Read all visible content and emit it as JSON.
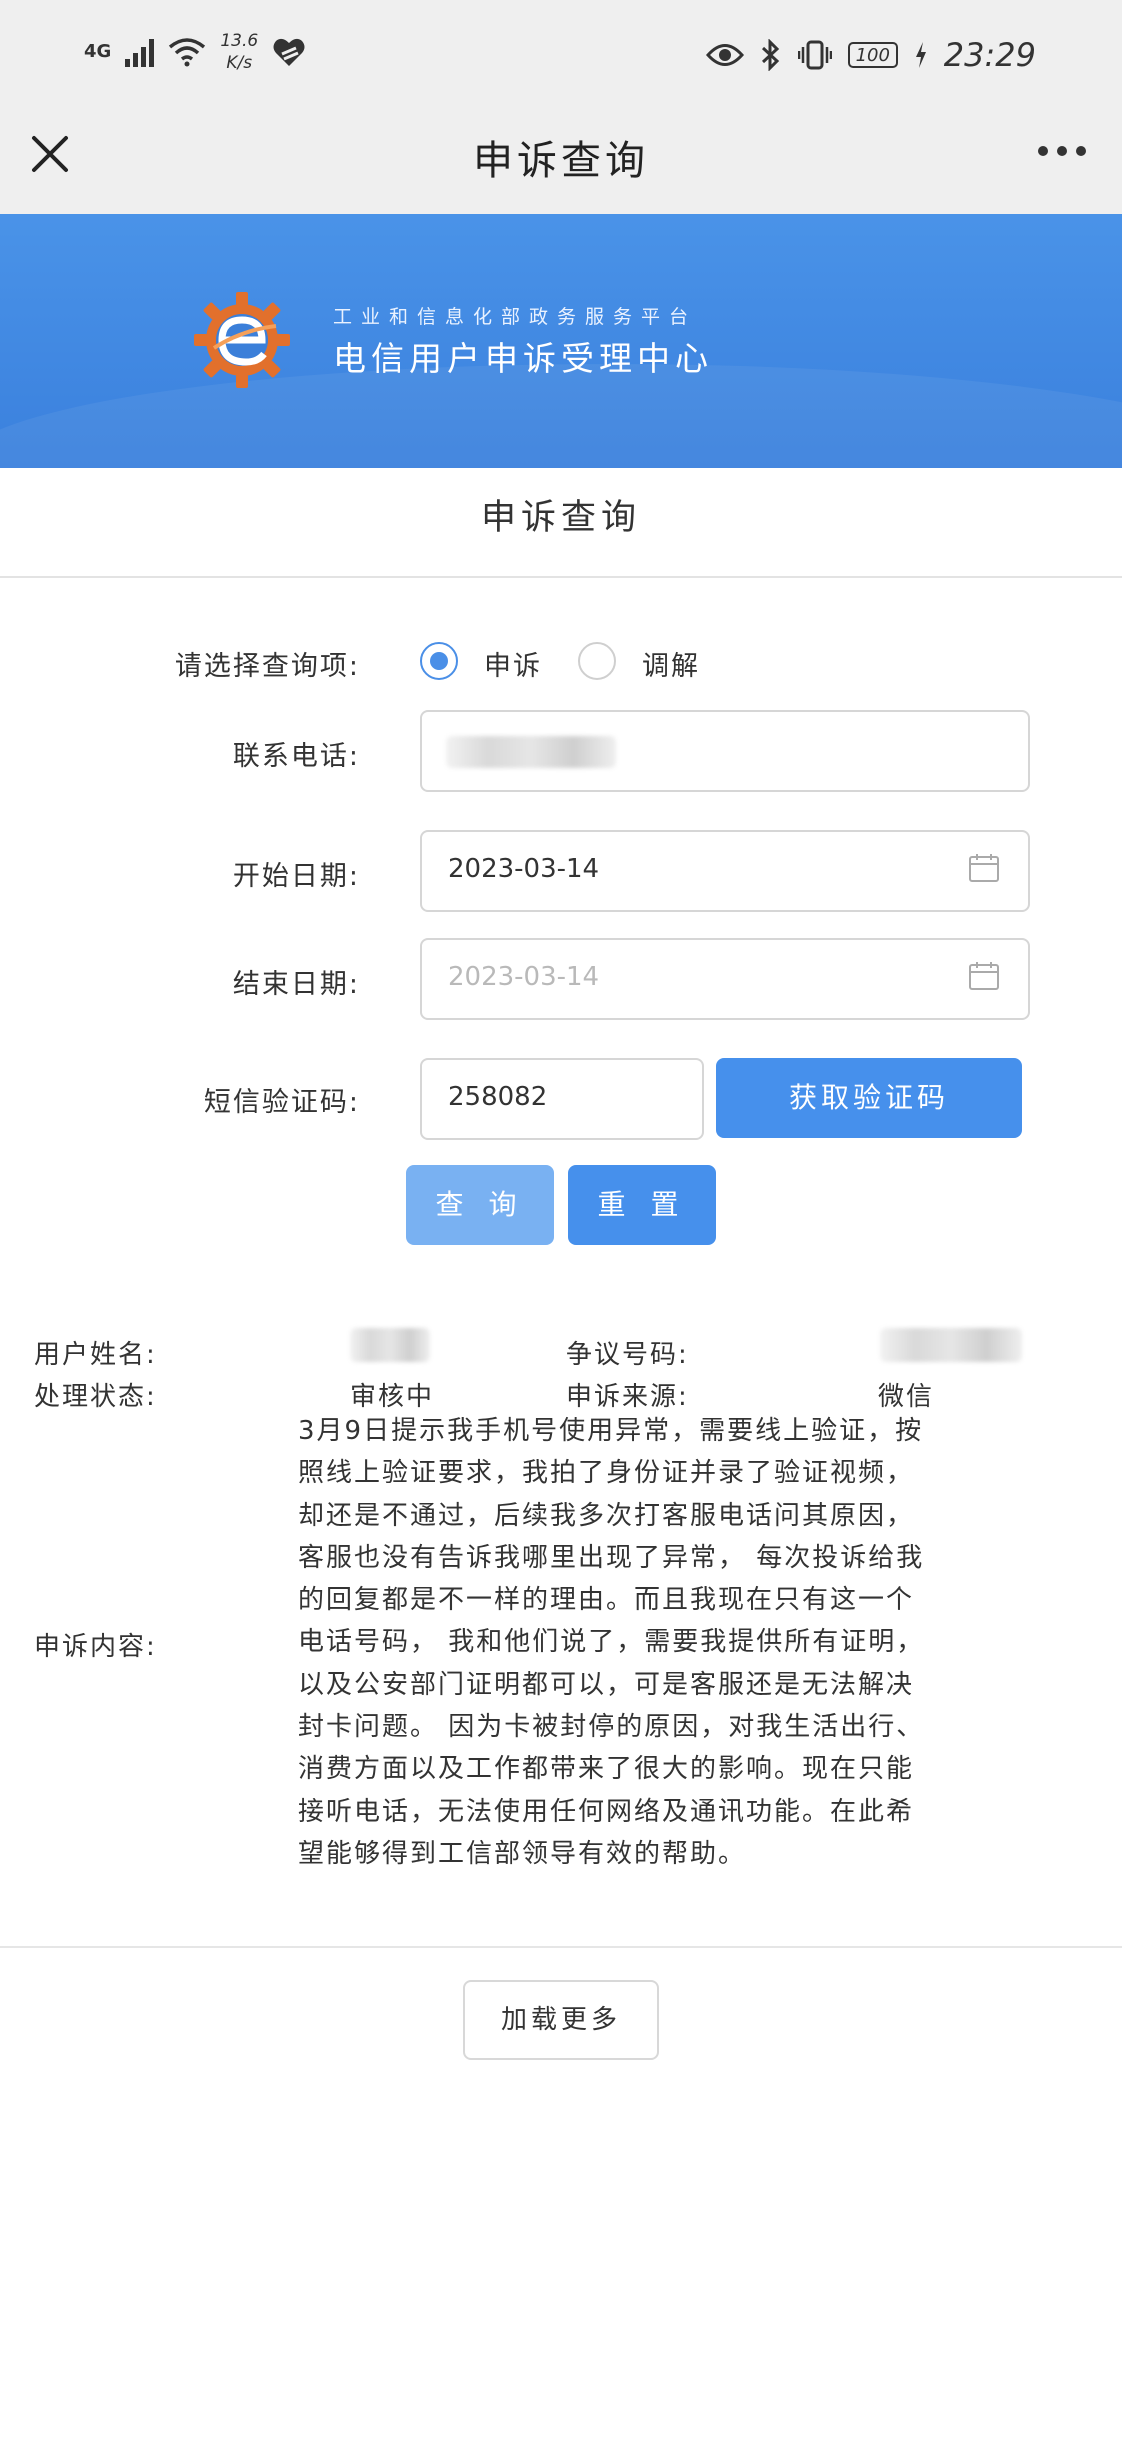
{
  "status_bar": {
    "network": "4G",
    "speed_value": "13.6",
    "speed_unit": "K/s",
    "battery": "100",
    "time": "23:29"
  },
  "nav": {
    "title": "申诉查询",
    "close_icon": "close-icon",
    "more_icon": "more-icon"
  },
  "banner": {
    "subtitle": "工业和信息化部政务服务平台",
    "title": "电信用户申诉受理中心"
  },
  "section_title": "申诉查询",
  "form": {
    "query_type_label": "请选择查询项:",
    "options": [
      {
        "label": "申诉",
        "selected": true
      },
      {
        "label": "调解",
        "selected": false
      }
    ],
    "phone_label": "联系电话:",
    "phone_value": "",
    "start_date_label": "开始日期:",
    "start_date_value": "2023-03-14",
    "end_date_label": "结束日期:",
    "end_date_placeholder": "2023-03-14",
    "sms_label": "短信验证码:",
    "sms_value": "258082",
    "get_code_button": "获取验证码",
    "query_button": "查 询",
    "reset_button": "重 置"
  },
  "result": {
    "user_name_label": "用户姓名:",
    "user_name_value": "",
    "dispute_number_label": "争议号码:",
    "dispute_number_value": "",
    "status_label": "处理状态:",
    "status_value": "审核中",
    "source_label": "申诉来源:",
    "source_value": "微信",
    "content_label": "申诉内容:",
    "content_value": "3月9日提示我手机号使用异常，需要线上验证，按照线上验证要求，我拍了身份证并录了验证视频，却还是不通过，后续我多次打客服电话问其原因，客服也没有告诉我哪里出现了异常， 每次投诉给我的回复都是不一样的理由。而且我现在只有这一个电话号码， 我和他们说了，需要我提供所有证明，以及公安部门证明都可以，可是客服还是无法解决封卡问题。 因为卡被封停的原因，对我生活出行、消费方面以及工作都带来了很大的影响。现在只能接听电话，无法使用任何网络及通讯功能。在此希望能够得到工信部领导有效的帮助。"
  },
  "load_more_button": "加载更多",
  "colors": {
    "accent": "#4690ec",
    "banner": "#3a80dd",
    "query_button": "#79b1f2"
  }
}
